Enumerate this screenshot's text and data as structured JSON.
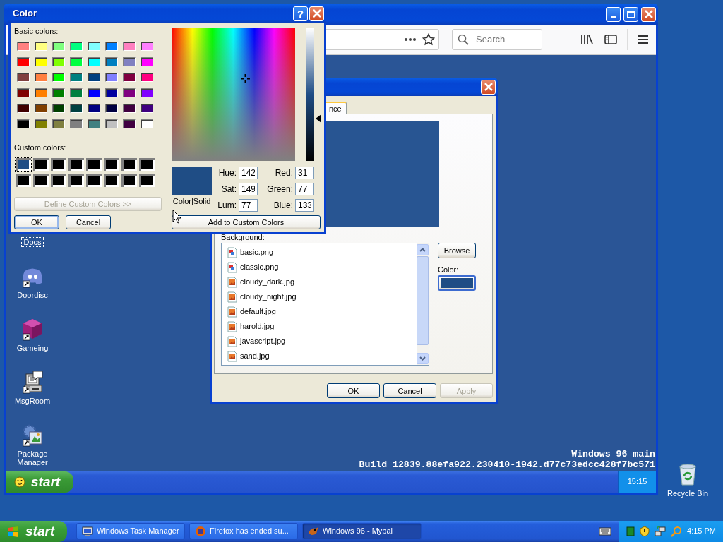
{
  "color_dialog": {
    "title": "Color",
    "help_button": "?",
    "basic_colors_label": "Basic colors:",
    "basic_colors": [
      {
        "color": "#ff8080"
      },
      {
        "color": "#ffff80"
      },
      {
        "color": "#80ff80"
      },
      {
        "color": "#00ff80"
      },
      {
        "color": "#80ffff"
      },
      {
        "color": "#0080ff"
      },
      {
        "color": "#ff80c0"
      },
      {
        "color": "#ff80ff"
      },
      {
        "color": "#ff0000"
      },
      {
        "color": "#ffff00"
      },
      {
        "color": "#80ff00"
      },
      {
        "color": "#00ff40"
      },
      {
        "color": "#00ffff"
      },
      {
        "color": "#0080c0"
      },
      {
        "color": "#8080c0"
      },
      {
        "color": "#ff00ff"
      },
      {
        "color": "#804040"
      },
      {
        "color": "#ff8040"
      },
      {
        "color": "#00ff00"
      },
      {
        "color": "#008080"
      },
      {
        "color": "#004080"
      },
      {
        "color": "#8080ff"
      },
      {
        "color": "#800040"
      },
      {
        "color": "#ff0080"
      },
      {
        "color": "#800000"
      },
      {
        "color": "#ff8000"
      },
      {
        "color": "#008000"
      },
      {
        "color": "#008040"
      },
      {
        "color": "#0000ff"
      },
      {
        "color": "#0000a0"
      },
      {
        "color": "#800080"
      },
      {
        "color": "#8000ff"
      },
      {
        "color": "#400000"
      },
      {
        "color": "#804000"
      },
      {
        "color": "#004000"
      },
      {
        "color": "#004040"
      },
      {
        "color": "#000080"
      },
      {
        "color": "#000040"
      },
      {
        "color": "#400040"
      },
      {
        "color": "#400080"
      },
      {
        "color": "#000000"
      },
      {
        "color": "#808000"
      },
      {
        "color": "#808040"
      },
      {
        "color": "#808080"
      },
      {
        "color": "#408080"
      },
      {
        "color": "#c0c0c0"
      },
      {
        "color": "#400040"
      },
      {
        "color": "#ffffff"
      }
    ],
    "custom_colors_label": "Custom colors:",
    "custom_colors": [
      {
        "color": "#1f4d85",
        "selected": true
      },
      {
        "color": "#000000",
        "selected": false
      },
      {
        "color": "#000000",
        "selected": false
      },
      {
        "color": "#000000",
        "selected": false
      },
      {
        "color": "#000000",
        "selected": false
      },
      {
        "color": "#000000",
        "selected": false
      },
      {
        "color": "#000000",
        "selected": false
      },
      {
        "color": "#000000",
        "selected": false
      },
      {
        "color": "#000000",
        "selected": false
      },
      {
        "color": "#000000",
        "selected": false
      },
      {
        "color": "#000000",
        "selected": false
      },
      {
        "color": "#000000",
        "selected": false
      },
      {
        "color": "#000000",
        "selected": false
      },
      {
        "color": "#000000",
        "selected": false
      },
      {
        "color": "#000000",
        "selected": false
      },
      {
        "color": "#000000",
        "selected": false
      }
    ],
    "define_button": {
      "label": "Define Custom Colors >>",
      "disabled": true
    },
    "ok_button": "OK",
    "cancel_button": "Cancel",
    "luminance_slider": {
      "level": 0.32
    },
    "swatch_label": "Color|Solid",
    "fields": [
      {
        "label": "Hue:",
        "value": "142"
      },
      {
        "label": "Sat:",
        "value": "149"
      },
      {
        "label": "Lum:",
        "value": "77"
      },
      {
        "label": "Red:",
        "value": "31"
      },
      {
        "label": "Green:",
        "value": "77"
      },
      {
        "label": "Blue:",
        "value": "133"
      }
    ],
    "add_button": "Add to Custom Colors"
  },
  "browser": {
    "search": {
      "placeholder": "Search"
    }
  },
  "display_properties": {
    "tab": {
      "label": "nce",
      "selected": true
    },
    "background_label": "Background:",
    "files": [
      {
        "label": "basic.png",
        "kind": "png",
        "selected": false
      },
      {
        "label": "classic.png",
        "kind": "png",
        "selected": false
      },
      {
        "label": "cloudy_dark.jpg",
        "kind": "jpg",
        "selected": false
      },
      {
        "label": "cloudy_night.jpg",
        "kind": "jpg",
        "selected": false
      },
      {
        "label": "default.jpg",
        "kind": "jpg",
        "selected": false
      },
      {
        "label": "harold.jpg",
        "kind": "jpg",
        "selected": false
      },
      {
        "label": "javascript.jpg",
        "kind": "jpg",
        "selected": false
      },
      {
        "label": "sand.jpg",
        "kind": "jpg",
        "selected": false
      }
    ],
    "browse_button": "Browse",
    "color_label": "Color:",
    "buttons": [
      {
        "label": "OK",
        "disabled": false
      },
      {
        "label": "Cancel",
        "disabled": false
      },
      {
        "label": "Apply",
        "disabled": true
      }
    ]
  },
  "win96": {
    "icons": [
      {
        "label": "Docs",
        "selected": true
      },
      {
        "label": "Doordisc",
        "kind": "chat",
        "selected": false
      },
      {
        "label": "Gameing",
        "kind": "cube",
        "selected": false
      },
      {
        "label": "MsgRoom",
        "kind": "computer",
        "selected": false
      },
      {
        "label": "Package Manager",
        "kind": "package",
        "selected": false
      }
    ],
    "build_lines": [
      "Windows 96 main",
      "Build 12839.88efa922.230410-1942.d77c73edcc428f7bc571"
    ],
    "start_button": "start",
    "clock": "15:15"
  },
  "desktop_icons": [
    {
      "label": "Recycle Bin"
    }
  ],
  "taskbar": {
    "start_button": "start",
    "tasks": [
      {
        "label": "Windows Task Manager",
        "kind": "monitor",
        "selected": false
      },
      {
        "label": "Firefox has ended su...",
        "kind": "browser",
        "selected": false
      },
      {
        "label": "Windows 96 - Mypal",
        "kind": "app",
        "selected": true
      }
    ],
    "clock": "4:15 PM"
  }
}
